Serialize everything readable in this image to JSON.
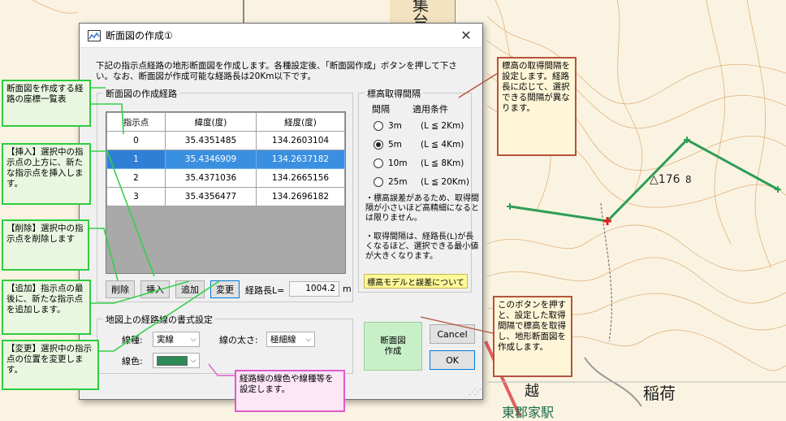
{
  "map": {
    "labels": {
      "top": "集\n台",
      "station": "東郡家駅",
      "place1": "越",
      "place2": "稲荷",
      "elev_num": "176",
      "elev_suffix": "8"
    },
    "route_color": "#2e9e55",
    "point_color": "#e02020"
  },
  "dialog": {
    "title": "断面図の作成①",
    "close_glyph": "✕",
    "description": "下記の指示点経路の地形断面図を作成します。各種設定後、「断面図作成」ボタンを押して下さい。なお、断面図が作成可能な経路長は20Km以下です。",
    "route_group": {
      "legend": "断面図の作成経路",
      "headers": [
        "指示点",
        "緯度(度)",
        "経度(度)"
      ],
      "rows": [
        {
          "idx": "0",
          "lat": "35.4351485",
          "lon": "134.2603104"
        },
        {
          "idx": "1",
          "lat": "35.4346909",
          "lon": "134.2637182",
          "selected": true
        },
        {
          "idx": "2",
          "lat": "35.4371036",
          "lon": "134.2665156"
        },
        {
          "idx": "3",
          "lat": "35.4356477",
          "lon": "134.2696182"
        }
      ],
      "delete_label": "削除",
      "insert_label": "挿入",
      "add_label": "追加",
      "change_label": "変更",
      "length_label": "経路長L=",
      "length_value": "1004.2",
      "length_unit": "m"
    },
    "elevation_group": {
      "legend": "標高取得間隔",
      "col_interval": "間隔",
      "col_condition": "適用条件",
      "options": [
        {
          "interval": "3m",
          "condition": "(L ≦ 2Km)",
          "selected": false
        },
        {
          "interval": "5m",
          "condition": "(L ≦ 4Km)",
          "selected": true
        },
        {
          "interval": "10m",
          "condition": "(L ≦ 8Km)",
          "selected": false
        },
        {
          "interval": "25m",
          "condition": "(L ≦ 20Km)",
          "selected": false
        }
      ],
      "note1": "・標高誤差があるため、取得間隔が小さいほど高精細になるとは限りません。",
      "note2": "・取得間隔は、経路長(L)が長くなるほど、選択できる最小値が大きくなります。",
      "model_button": "標高モデルと誤差について"
    },
    "style_group": {
      "legend": "地図上の経路線の書式設定",
      "linetype_label": "線種:",
      "linetype_value": "実線",
      "width_label": "線の太さ:",
      "width_value": "極細線",
      "color_label": "線色:",
      "color_value": "#2e8b57"
    },
    "create_button": "断面図\n作成",
    "cancel_button": "Cancel",
    "ok_button": "OK"
  },
  "callouts": {
    "route_list": "断面図を作成する経路の座標一覧表",
    "insert": "【挿入】選択中の指示点の上方に、新たな指示点を挿入します。",
    "delete": "【削除】選択中の指示点を削除します",
    "add": "【追加】指示点の最後に、新たな指示点を追加します。",
    "change": "【変更】選択中の指示点の位置を変更します。",
    "elevation": "標高の取得間隔を設定します。経路長に応じて、選択できる間隔が異なります。",
    "create": "このボタンを押すと、設定した取得間隔で標高を取得し、地形断面図を作成します。",
    "style": "経路線の線色や線種等を設定します。"
  }
}
